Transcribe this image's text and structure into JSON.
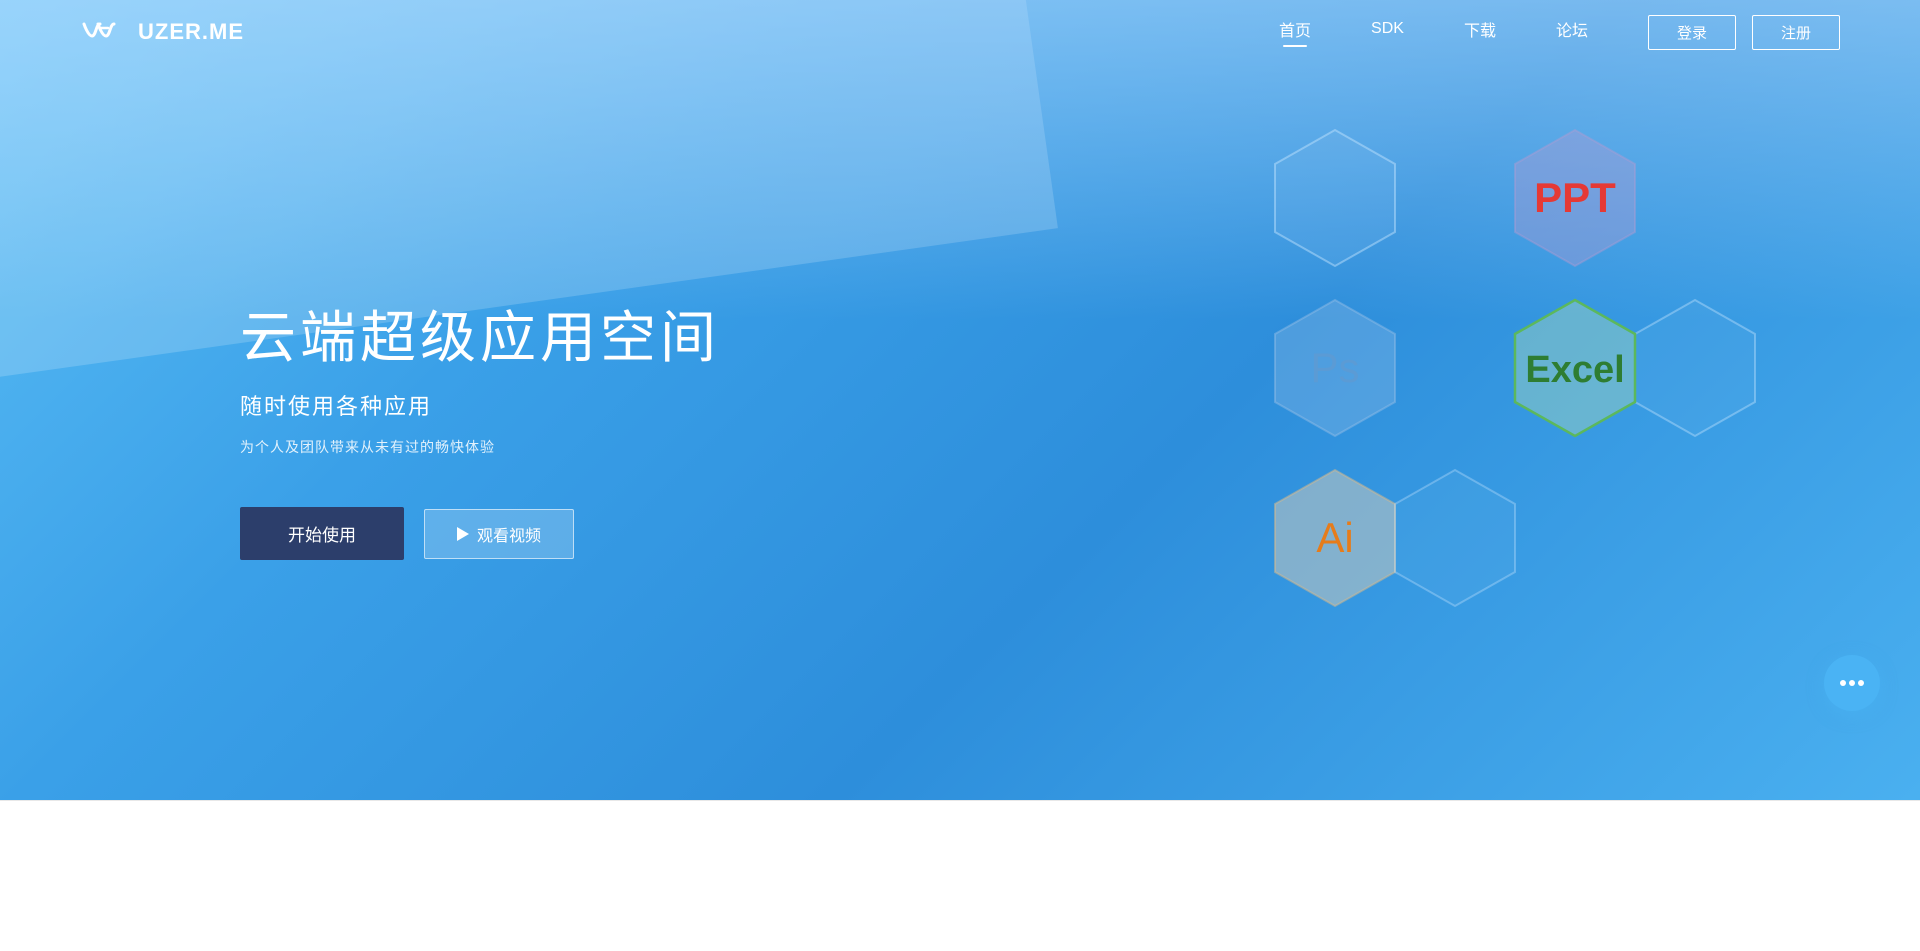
{
  "nav": {
    "logo_text": "UZER.ME",
    "links": [
      {
        "label": "首页",
        "active": true
      },
      {
        "label": "SDK",
        "active": false
      },
      {
        "label": "下载",
        "active": false
      },
      {
        "label": "论坛",
        "active": false
      }
    ],
    "btn_login": "登录",
    "btn_register": "注册"
  },
  "hero": {
    "title": "云端超级应用空间",
    "subtitle": "随时使用各种应用",
    "desc": "为个人及团队带来从未有过的畅快体验",
    "btn_start": "开始使用",
    "btn_video": "观看视频"
  },
  "hexagons": [
    {
      "label": "PPT",
      "color": "#e53935",
      "bg_from": "rgba(180,160,210,0.4)",
      "bg_to": "rgba(200,180,220,0.6)",
      "border": "rgba(180,160,210,0.5)"
    },
    {
      "label": "Ps",
      "color": "#5b9bd5",
      "bg_from": "rgba(140,180,220,0.3)",
      "bg_to": "rgba(160,200,235,0.5)",
      "border": "rgba(140,180,220,0.5)"
    },
    {
      "label": "Excel",
      "color": "#2e7d32",
      "bg_from": "rgba(180,220,180,0.35)",
      "bg_to": "rgba(200,235,200,0.55)",
      "border": "#4caf50"
    },
    {
      "label": "Ai",
      "color": "#e67c1b",
      "bg_from": "rgba(235,210,170,0.4)",
      "bg_to": "rgba(245,225,190,0.6)",
      "border": "rgba(220,190,140,0.5)"
    },
    {
      "label": "",
      "color": "transparent",
      "bg_from": "rgba(255,255,255,0.05)",
      "bg_to": "rgba(255,255,255,0.1)",
      "border": "rgba(200,230,255,0.4)"
    },
    {
      "label": "",
      "color": "transparent",
      "bg_from": "rgba(255,255,255,0.05)",
      "bg_to": "rgba(255,255,255,0.1)",
      "border": "rgba(200,230,255,0.4)"
    }
  ],
  "bottom": {
    "text": ""
  }
}
